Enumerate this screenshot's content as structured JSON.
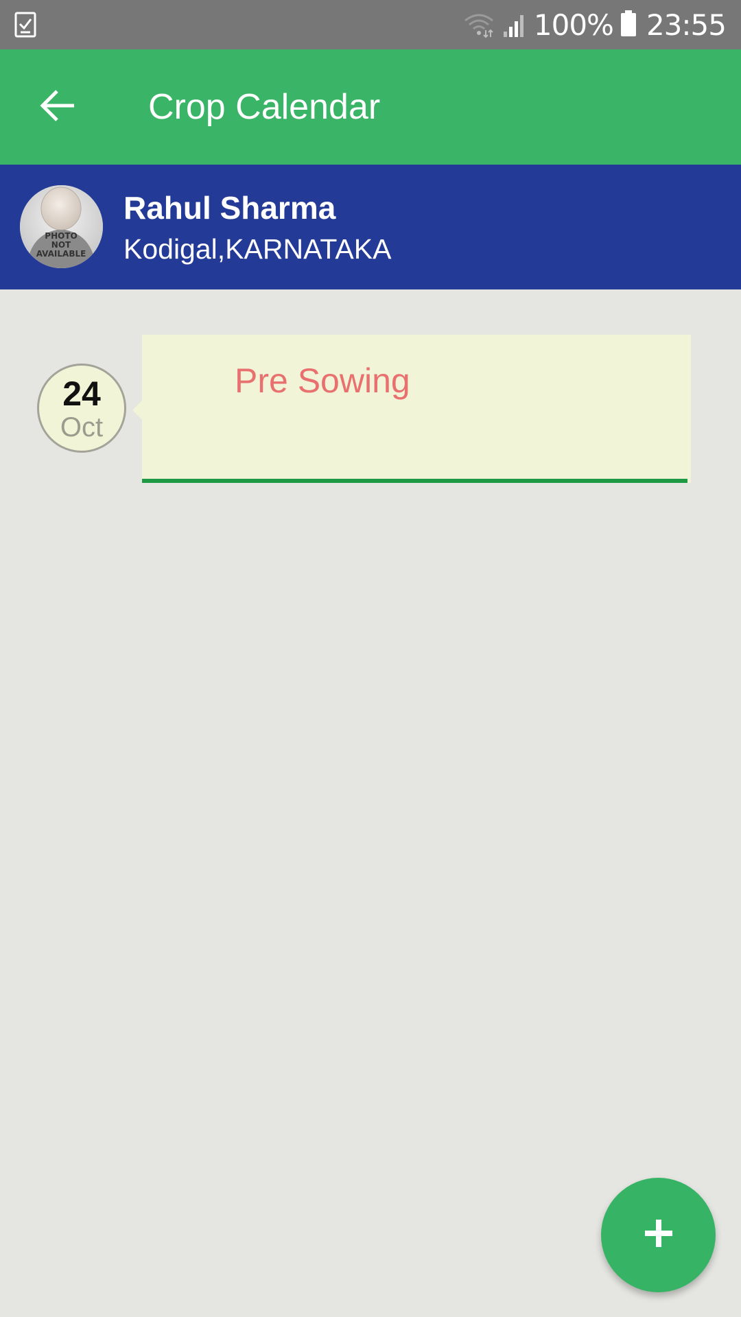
{
  "status_bar": {
    "notification_icon": "task-check-icon",
    "wifi_icon": "wifi-icon",
    "signal_icon": "cell-signal-icon",
    "battery_percent": "100%",
    "battery_icon": "battery-icon",
    "time": "23:55"
  },
  "app_bar": {
    "back_icon": "arrow-back-icon",
    "title": "Crop Calendar",
    "color": "#3ab466"
  },
  "profile": {
    "avatar_label": [
      "PHOTO",
      "NOT",
      "AVAILABLE"
    ],
    "name": "Rahul Sharma",
    "location": "Kodigal,KARNATAKA",
    "color": "#233a97"
  },
  "timeline": [
    {
      "day": "24",
      "month": "Oct",
      "title": "Pre Sowing"
    }
  ],
  "fab": {
    "icon": "plus-icon",
    "color": "#37b365"
  }
}
